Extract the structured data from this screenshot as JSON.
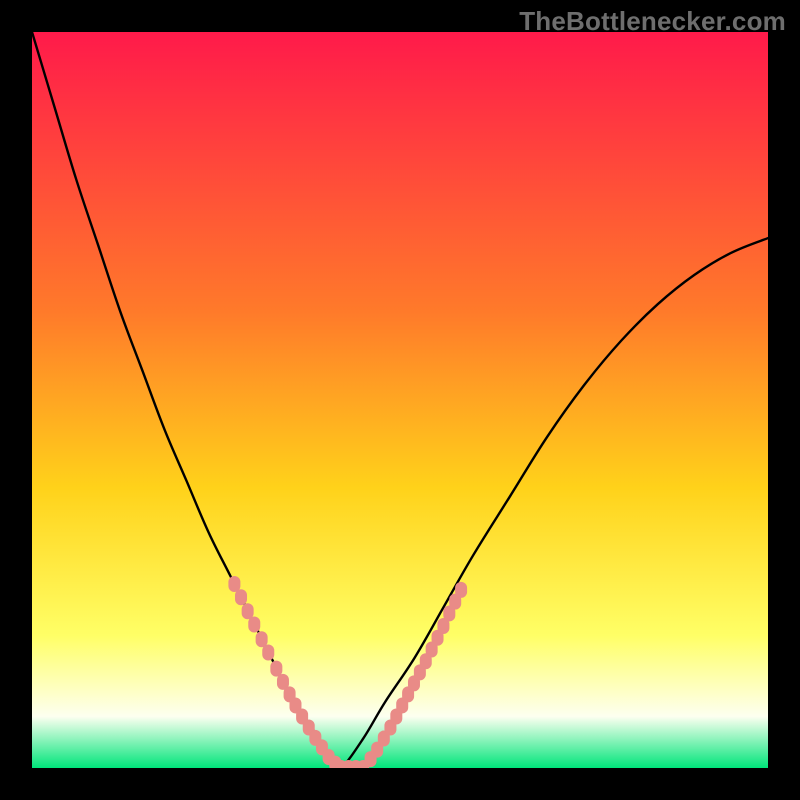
{
  "watermark": "TheBottlenecker.com",
  "colors": {
    "frame": "#000000",
    "grad_top": "#ff1a4a",
    "grad_mid1": "#ff7a2a",
    "grad_mid2": "#ffd21a",
    "grad_low1": "#ffff66",
    "grad_low2": "#fdfff0",
    "grad_bottom": "#00e57a",
    "curve": "#000000",
    "marker": "#e98b87"
  },
  "chart_data": {
    "type": "line",
    "title": "",
    "xlabel": "",
    "ylabel": "",
    "xlim": [
      0,
      100
    ],
    "ylim": [
      0,
      100
    ],
    "series": [
      {
        "name": "bottleneck-curve",
        "x": [
          0,
          3,
          6,
          9,
          12,
          15,
          18,
          21,
          24,
          27,
          30,
          33,
          35,
          37,
          39,
          41,
          42,
          45,
          48,
          52,
          56,
          60,
          65,
          70,
          75,
          80,
          85,
          90,
          95,
          100
        ],
        "y": [
          100,
          90,
          80,
          71,
          62,
          54,
          46,
          39,
          32,
          26,
          20,
          14,
          10,
          7,
          4,
          1,
          0,
          4,
          9,
          15,
          22,
          29,
          37,
          45,
          52,
          58,
          63,
          67,
          70,
          72
        ]
      }
    ],
    "markers_left": [
      {
        "x": 27.5,
        "y": 25
      },
      {
        "x": 28.4,
        "y": 23.2
      },
      {
        "x": 29.3,
        "y": 21.3
      },
      {
        "x": 30.2,
        "y": 19.5
      },
      {
        "x": 31.2,
        "y": 17.5
      },
      {
        "x": 32.1,
        "y": 15.7
      },
      {
        "x": 33.2,
        "y": 13.5
      },
      {
        "x": 34.1,
        "y": 11.7
      },
      {
        "x": 35.0,
        "y": 10.0
      },
      {
        "x": 35.8,
        "y": 8.5
      },
      {
        "x": 36.7,
        "y": 7.0
      },
      {
        "x": 37.6,
        "y": 5.5
      },
      {
        "x": 38.5,
        "y": 4.1
      },
      {
        "x": 39.4,
        "y": 2.8
      },
      {
        "x": 40.3,
        "y": 1.5
      },
      {
        "x": 41.2,
        "y": 0.6
      }
    ],
    "markers_bottom": [
      {
        "x": 42.0,
        "y": 0.0
      },
      {
        "x": 43.0,
        "y": 0.0
      },
      {
        "x": 44.0,
        "y": 0.0
      },
      {
        "x": 45.0,
        "y": 0.0
      }
    ],
    "markers_right": [
      {
        "x": 46.0,
        "y": 1.2
      },
      {
        "x": 46.9,
        "y": 2.5
      },
      {
        "x": 47.8,
        "y": 4.0
      },
      {
        "x": 48.7,
        "y": 5.5
      },
      {
        "x": 49.5,
        "y": 7.0
      },
      {
        "x": 50.3,
        "y": 8.5
      },
      {
        "x": 51.1,
        "y": 10.0
      },
      {
        "x": 51.9,
        "y": 11.5
      },
      {
        "x": 52.7,
        "y": 13.0
      },
      {
        "x": 53.5,
        "y": 14.5
      },
      {
        "x": 54.3,
        "y": 16.1
      },
      {
        "x": 55.1,
        "y": 17.7
      },
      {
        "x": 55.9,
        "y": 19.3
      },
      {
        "x": 56.7,
        "y": 21.0
      },
      {
        "x": 57.5,
        "y": 22.6
      },
      {
        "x": 58.3,
        "y": 24.2
      }
    ]
  }
}
